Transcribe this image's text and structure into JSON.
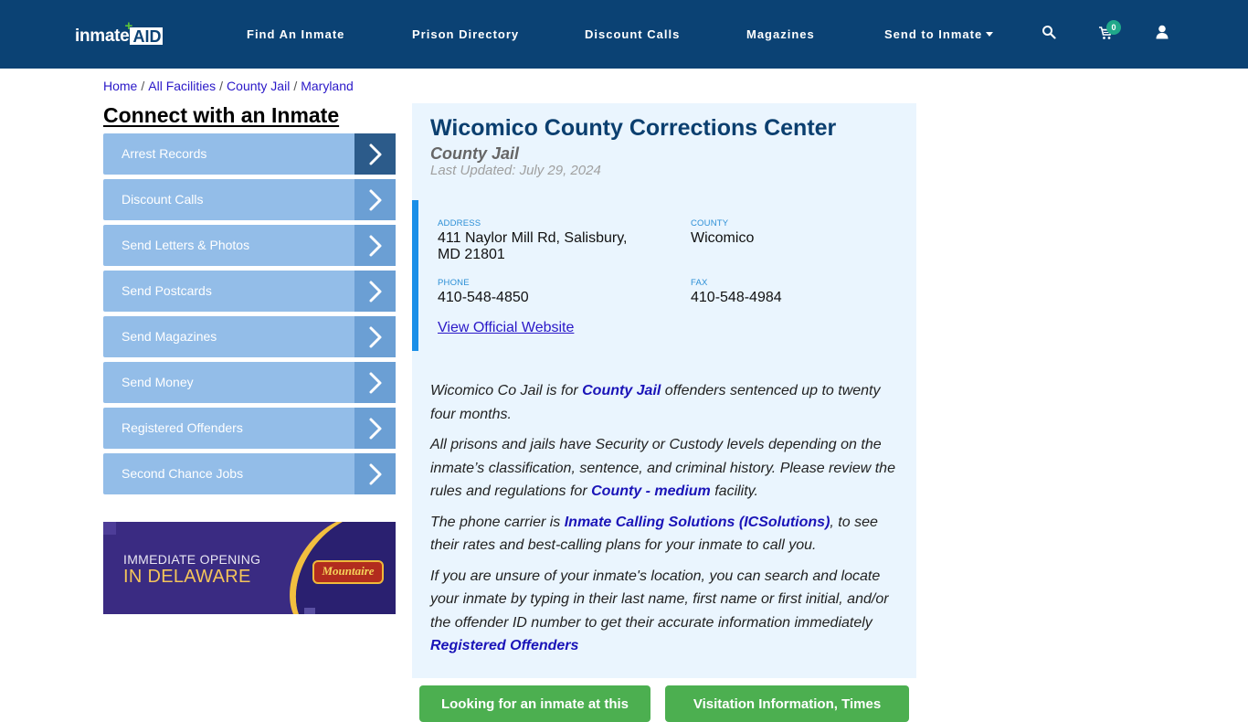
{
  "header": {
    "logo": {
      "part1": "inmate",
      "part2": "AID",
      "plus": "+"
    },
    "nav": [
      {
        "label": "Find An Inmate"
      },
      {
        "label": "Prison Directory"
      },
      {
        "label": "Discount Calls"
      },
      {
        "label": "Magazines"
      },
      {
        "label": "Send to Inmate",
        "has_dropdown": true
      }
    ],
    "icons": {
      "search": "search-icon",
      "cart": "cart-icon",
      "user": "user-icon"
    },
    "cart_count": "0"
  },
  "breadcrumb": [
    {
      "label": "Home"
    },
    {
      "label": "All Facilities"
    },
    {
      "label": "County Jail"
    },
    {
      "label": "Maryland"
    }
  ],
  "breadcrumb_separator": "/",
  "sidebar": {
    "title": "Connect with an Inmate",
    "items": [
      {
        "label": "Arrest Records",
        "active": true
      },
      {
        "label": "Discount Calls"
      },
      {
        "label": "Send Letters & Photos"
      },
      {
        "label": "Send Postcards"
      },
      {
        "label": "Send Magazines"
      },
      {
        "label": "Send Money"
      },
      {
        "label": "Registered Offenders"
      },
      {
        "label": "Second Chance Jobs"
      }
    ],
    "ad": {
      "line1": "IMMEDIATE OPENING",
      "line2": "IN DELAWARE",
      "brand": "Mountaire"
    }
  },
  "facility": {
    "name": "Wicomico County Corrections Center",
    "type": "County Jail",
    "last_updated": "Last Updated: July 29, 2024",
    "address_label": "ADDRESS",
    "address_line1": "411 Naylor Mill Rd, Salisbury,",
    "address_line2": "MD 21801",
    "county_label": "COUNTY",
    "county": "Wicomico",
    "phone_label": "PHONE",
    "phone": "410-548-4850",
    "fax_label": "FAX",
    "fax": "410-548-4984",
    "website_link": "View Official Website"
  },
  "description": {
    "p1_pre": "Wicomico Co Jail is for ",
    "p1_link": "County Jail",
    "p1_post": " offenders sentenced up to twenty four months.",
    "p2_pre": "All prisons and jails have Security or Custody levels depending on the inmate’s classification, sentence, and criminal history. Please review the rules and regulations for ",
    "p2_link": "County - medium",
    "p2_post": " facility.",
    "p3_pre": "The phone carrier is ",
    "p3_link": "Inmate Calling Solutions (ICSolutions)",
    "p3_post": ", to see their rates and best-calling plans for your inmate to call you.",
    "p4_text": "If you are unsure of your inmate's location, you can search and locate your inmate by typing in their last name, first name or first initial, and/or the offender ID number to get their accurate information immediately",
    "p4_link": "Registered Offenders"
  },
  "buttons": {
    "left": "Looking for an inmate at this",
    "right": "Visitation Information, Times"
  },
  "colors": {
    "header_bg": "#0b4274",
    "panel_bg": "#eaf5fe",
    "accent": "#1a8fe8",
    "sidebar_item": "#93bde8",
    "sidebar_chevron": "#6b9fd4",
    "sidebar_chevron_active": "#2c5b8a",
    "button_green": "#4caf50",
    "link": "#2a18c8"
  }
}
